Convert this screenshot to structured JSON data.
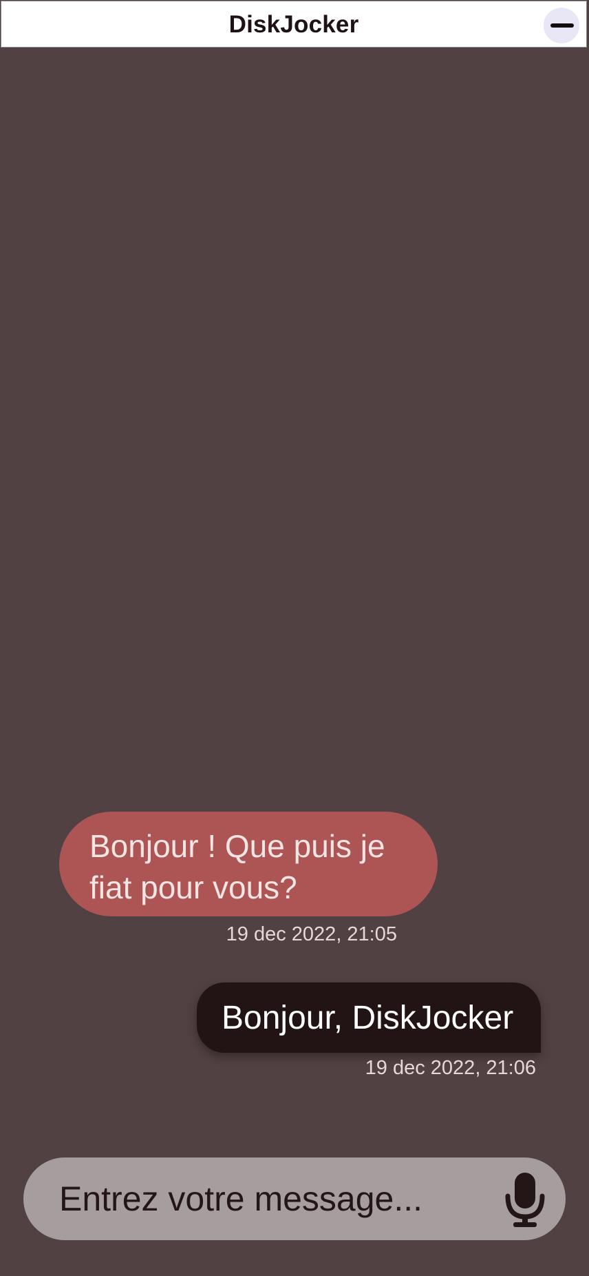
{
  "header": {
    "title": "DiskJocker",
    "minimize_icon": "minus-icon"
  },
  "messages": [
    {
      "sender": "bot",
      "text": "Bonjour ! Que puis je fiat pour vous?",
      "timestamp": "19 dec 2022, 21:05"
    },
    {
      "sender": "user",
      "text": "Bonjour, DiskJocker",
      "timestamp": "19 dec 2022, 21:06"
    }
  ],
  "composer": {
    "placeholder": "Entrez votre message...",
    "value": "",
    "mic_icon": "microphone-icon"
  },
  "colors": {
    "background": "#524143",
    "header_background": "#ffffff",
    "bot_bubble": "#ad5555",
    "user_bubble": "#221415",
    "composer_background": "#a69e9e",
    "minimize_button_background": "#e9e7f6"
  }
}
